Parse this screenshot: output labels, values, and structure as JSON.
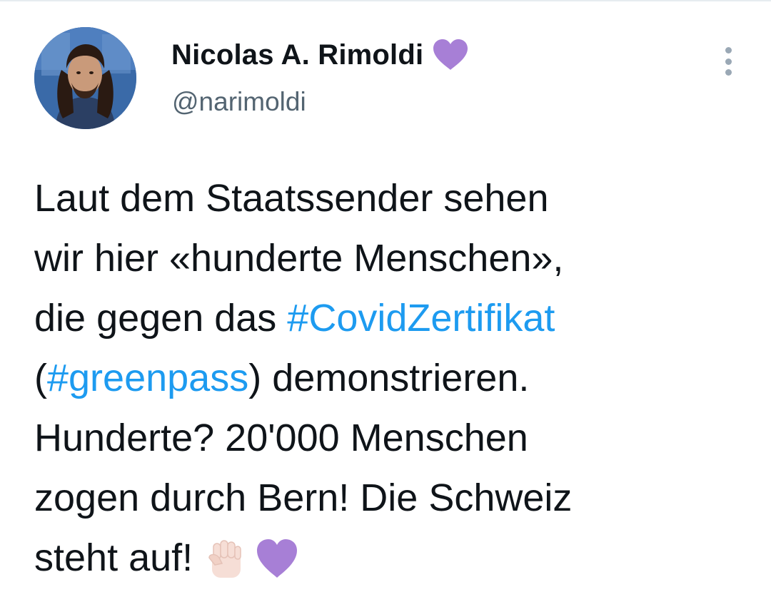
{
  "author": {
    "display_name": "Nicolas A. Rimoldi",
    "handle": "@narimoldi",
    "badge_icon": "purple-heart-icon"
  },
  "menu": {
    "icon": "more-vertical-icon"
  },
  "tweet": {
    "lines": {
      "l1": "Laut dem Staatssender sehen",
      "l2": "wir hier «hunderte Menschen»,",
      "l3_prefix": "die gegen das ",
      "l3_hashtag": "#CovidZertifikat",
      "l4_open": "(",
      "l4_hashtag": "#greenpass",
      "l4_suffix": ") demonstrieren.",
      "l5": "Hunderte? 20'000 Menschen",
      "l6": "zogen durch Bern! Die Schweiz",
      "l7": "steht auf! "
    },
    "hashtags": [
      "#CovidZertifikat",
      "#greenpass"
    ],
    "emojis": [
      "raised-fist-light-skin-icon",
      "purple-heart-icon"
    ]
  },
  "colors": {
    "text": "#0f1419",
    "secondary": "#536471",
    "link": "#1d9bf0",
    "heart": "#a77fd6"
  }
}
